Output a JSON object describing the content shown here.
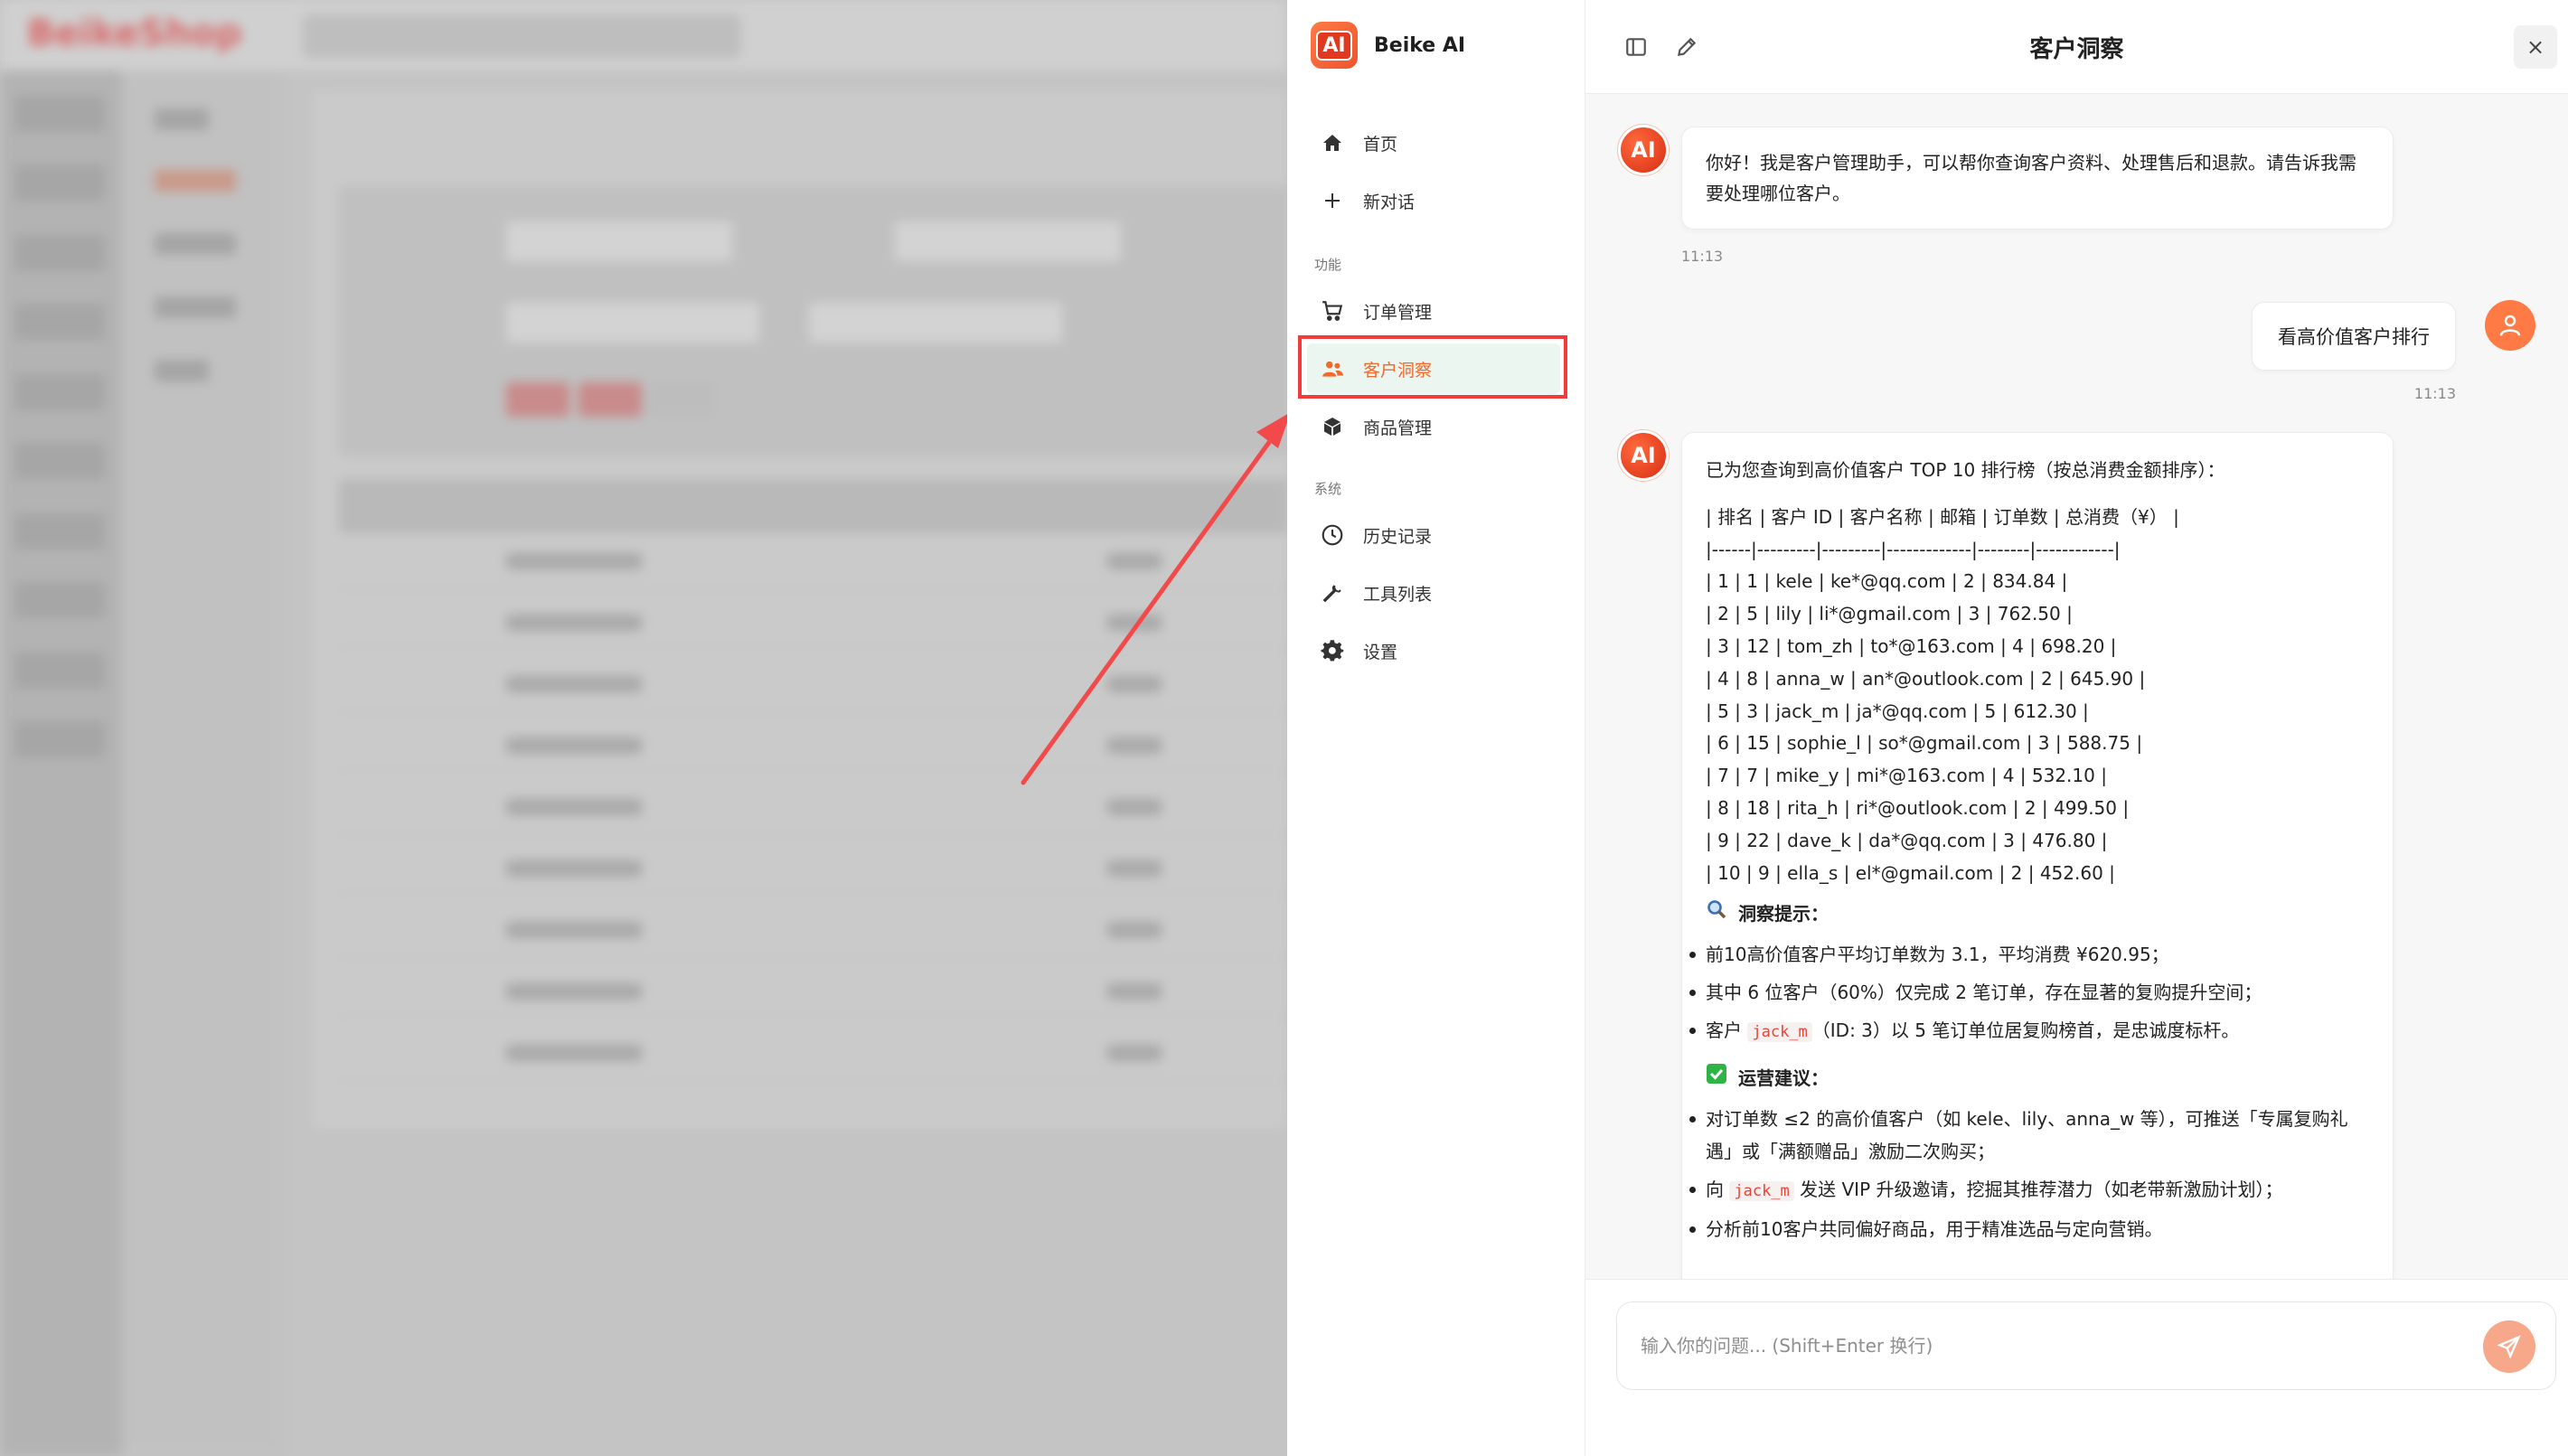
{
  "background": {
    "logo": "BeikeShop"
  },
  "ai_menu": {
    "brand": "Beike AI",
    "items_top": [
      {
        "label": "首页",
        "icon": "home-icon"
      },
      {
        "label": "新对话",
        "icon": "plus-icon"
      }
    ],
    "section_features": "功能",
    "items_features": [
      {
        "label": "订单管理",
        "icon": "cart-icon"
      },
      {
        "label": "客户洞察",
        "icon": "users-icon",
        "active": true
      },
      {
        "label": "商品管理",
        "icon": "box-icon"
      }
    ],
    "section_system": "系统",
    "items_system": [
      {
        "label": "历史记录",
        "icon": "clock-icon"
      },
      {
        "label": "工具列表",
        "icon": "wrench-icon"
      },
      {
        "label": "设置",
        "icon": "gear-icon"
      }
    ]
  },
  "chat": {
    "title": "客户洞察",
    "close_label": "×",
    "avatar_ai_text": "AI",
    "messages": {
      "greeting": "你好！我是客户管理助手，可以帮你查询客户资料、处理售后和退款。请告诉我需要处理哪位客户。",
      "greeting_time": "11:13",
      "user": "看高价值客户排行",
      "user_time": "11:13",
      "answer_intro": "已为您查询到高价值客户 TOP 10 排行榜（按总消费金额排序）：",
      "table_lines": [
        "| 排名 | 客户 ID | 客户名称 | 邮箱 | 订单数 | 总消费（¥） |",
        "|------|---------|---------|-------------|--------|------------|",
        "| 1 | 1 | kele | ke*@qq.com | 2 | 834.84 |",
        "| 2 | 5 | lily | li*@gmail.com | 3 | 762.50 |",
        "| 3 | 12 | tom_zh | to*@163.com | 4 | 698.20 |",
        "| 4 | 8 | anna_w | an*@outlook.com | 2 | 645.90 |",
        "| 5 | 3 | jack_m | ja*@qq.com | 5 | 612.30 |",
        "| 6 | 15 | sophie_l | so*@gmail.com | 3 | 588.75 |",
        "| 7 | 7 | mike_y | mi*@163.com | 4 | 532.10 |",
        "| 8 | 18 | rita_h | ri*@outlook.com | 2 | 499.50 |",
        "| 9 | 22 | dave_k | da*@qq.com | 3 | 476.80 |",
        "| 10 | 9 | ella_s | el*@gmail.com | 2 | 452.60 |"
      ],
      "insight_title": "洞察提示：",
      "insight_1": "前10高价值客户平均订单数为 3.1，平均消费 ¥620.95；",
      "insight_2": "其中 6 位客户（60%）仅完成 2 笔订单，存在显著的复购提升空间；",
      "insight_3_pre": "客户 ",
      "insight_3_code": "jack_m",
      "insight_3_post": "（ID: 3）以 5 笔订单位居复购榜首，是忠诚度标杆。",
      "ops_title": "运营建议：",
      "ops_1": "对订单数 ≤2 的高价值客户（如 kele、lily、anna_w 等），可推送「专属复购礼遇」或「满额赠品」激励二次购买；",
      "ops_2_pre": "向 ",
      "ops_2_code": "jack_m",
      "ops_2_post": " 发送 VIP 升级邀请，挖掘其推荐潜力（如老带新激励计划）；",
      "ops_3": "分析前10客户共同偏好商品，用于精准选品与定向营销。"
    },
    "input_placeholder": "输入你的问题... (Shift+Enter 换行)"
  },
  "colors": {
    "accent": "#f06a2e",
    "active_bg": "#eaf6ef",
    "highlight": "#f23b3b"
  }
}
